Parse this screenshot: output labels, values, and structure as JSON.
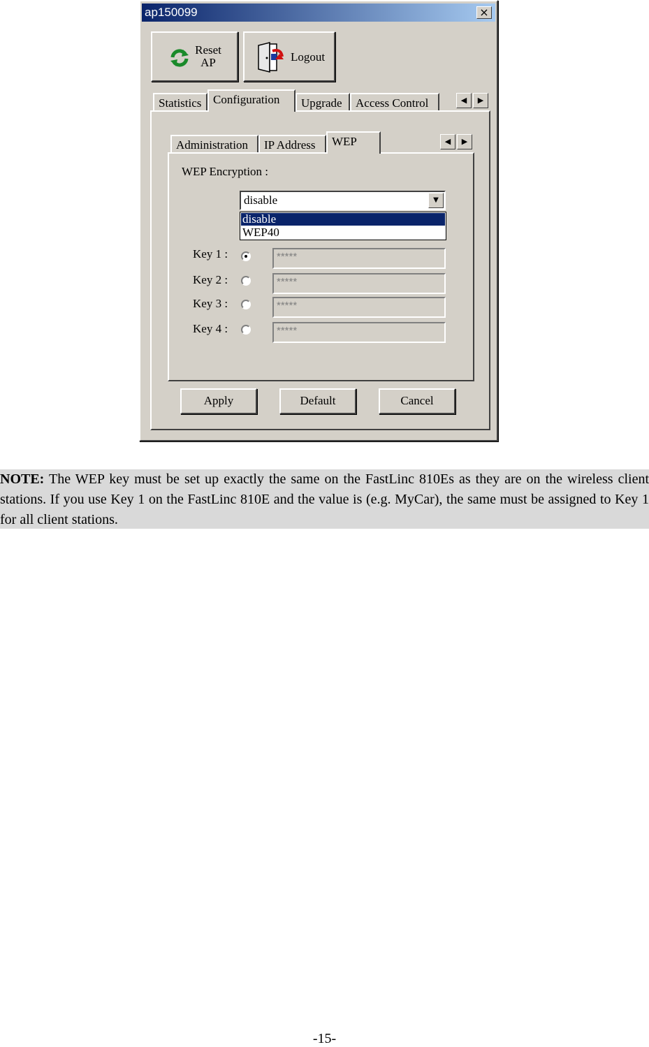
{
  "window": {
    "title": "ap150099",
    "close_label": "×"
  },
  "toolbar": {
    "reset_line1": "Reset",
    "reset_line2": "AP",
    "logout_label": "Logout"
  },
  "main_tabs": [
    {
      "label": "Statistics"
    },
    {
      "label": "Configuration"
    },
    {
      "label": "Upgrade"
    },
    {
      "label": "Access Control"
    }
  ],
  "sub_tabs": [
    {
      "label": "Administration"
    },
    {
      "label": "IP Address"
    },
    {
      "label": "WEP"
    }
  ],
  "arrows": {
    "left": "◀",
    "right": "▶"
  },
  "wep": {
    "encryption_label": "WEP Encryption :",
    "selected": "disable",
    "dropdown_arrow": "▼",
    "options": [
      "disable",
      "WEP40"
    ],
    "keys": [
      {
        "label": "Key 1 :",
        "value": "*****",
        "checked": true
      },
      {
        "label": "Key 2 :",
        "value": "*****",
        "checked": false
      },
      {
        "label": "Key 3 :",
        "value": "*****",
        "checked": false
      },
      {
        "label": "Key 4 :",
        "value": "*****",
        "checked": false
      }
    ]
  },
  "buttons": {
    "apply": "Apply",
    "default": "Default",
    "cancel": "Cancel"
  },
  "note": {
    "bold": "NOTE:",
    "text": " The WEP key must be set up exactly the same on the FastLinc 810Es as they are on the wireless client stations.   If you use Key 1 on the FastLinc 810E and the value is (e.g. MyCar), the same must be assigned to Key 1 for all client stations."
  },
  "page_number": "-15-",
  "colors": {
    "title_start": "#0a246a",
    "title_end": "#a6caf0",
    "dialog_face": "#d4d0c8",
    "note_bg": "#d9d9d9"
  }
}
